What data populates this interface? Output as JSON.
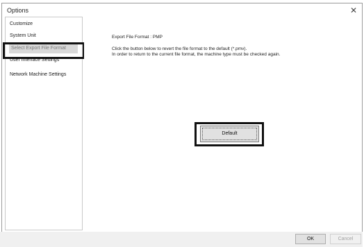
{
  "window": {
    "title": "Options",
    "close_glyph": "✕"
  },
  "sidebar": {
    "items": [
      {
        "label": "Customize"
      },
      {
        "label": "System Unit"
      },
      {
        "label": "Select Export File Format"
      },
      {
        "label": "User Interface Settings"
      },
      {
        "label": "Network Machine Settings"
      }
    ]
  },
  "content": {
    "format_line": "Export File Format : PMP",
    "info_line_1": "Click the button below to revert the file format to the default (*.pmv).",
    "info_line_2": "In order to return to the current file format, the machine type must be checked again.",
    "default_button": "Default"
  },
  "footer": {
    "ok_label": "OK",
    "cancel_label": "Cancel"
  },
  "icons": {
    "close": "close-icon"
  }
}
